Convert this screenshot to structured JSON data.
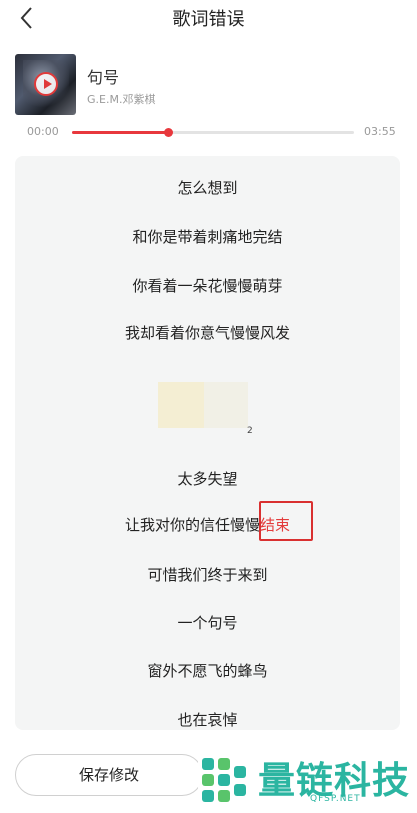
{
  "header": {
    "title": "歌词错误"
  },
  "song": {
    "title": "句号",
    "artist": "G.E.M.邓紫棋"
  },
  "player": {
    "current_time": "00:00",
    "total_time": "03:55",
    "progress": 0.34
  },
  "lyrics": [
    "怎么想到",
    "和你是带着刺痛地完结",
    "你看着一朵花慢慢萌芽",
    "我却看着你意气慢慢风发",
    "太多失望",
    "让我对你的信任慢慢",
    "可惜我们终于来到",
    "一个句号",
    "窗外不愿飞的蜂鸟",
    "也在哀悼"
  ],
  "lyric_highlight": "结束",
  "redaction_mark": "2",
  "actions": {
    "save_label": "保存修改"
  },
  "watermark": {
    "brand": "量链科技",
    "url": "QFSP.NET"
  },
  "colors": {
    "accent": "#e8383d",
    "panel": "#f4f5f5",
    "watermark": "#2bb5a1"
  },
  "icons": {
    "back": "chevron-left-icon",
    "play": "play-icon",
    "logo": "brand-logo-icon"
  }
}
